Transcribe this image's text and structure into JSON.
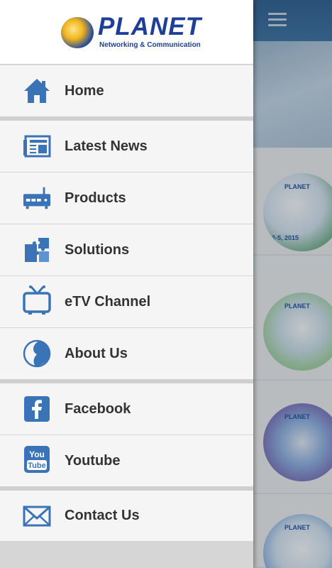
{
  "logo": {
    "word": "PLANET",
    "tagline": "Networking & Communication"
  },
  "menu": {
    "items": [
      {
        "label": "Home",
        "icon": "home-icon"
      },
      {
        "label": "Latest News",
        "icon": "newspaper-icon"
      },
      {
        "label": "Products",
        "icon": "router-icon"
      },
      {
        "label": "Solutions",
        "icon": "puzzle-icon"
      },
      {
        "label": "eTV Channel",
        "icon": "tv-icon"
      },
      {
        "label": "About Us",
        "icon": "planet-logo-icon"
      },
      {
        "label": "Facebook",
        "icon": "facebook-icon"
      },
      {
        "label": "Youtube",
        "icon": "youtube-icon"
      },
      {
        "label": "Contact Us",
        "icon": "mail-icon"
      }
    ]
  },
  "background": {
    "thumb1_brand": "PLANET",
    "thumb1_caption": "2-5, 2015",
    "thumb2_brand": "PLANET",
    "thumb3_brand": "PLANET",
    "thumb4_brand": "PLANET"
  },
  "colors": {
    "accent": "#3a74b6",
    "brand": "#1d3f98",
    "header": "#2b5e90"
  }
}
